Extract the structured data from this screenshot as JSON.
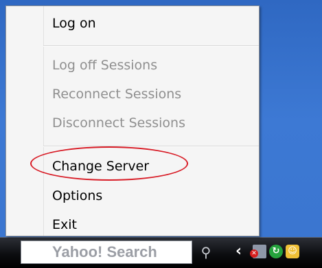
{
  "menu": {
    "items": [
      {
        "label": "Log on",
        "enabled": true
      },
      {
        "label": "Log off Sessions",
        "enabled": false
      },
      {
        "label": "Reconnect Sessions",
        "enabled": false
      },
      {
        "label": "Disconnect Sessions",
        "enabled": false
      },
      {
        "label": "Change Server",
        "enabled": true,
        "highlighted": true
      },
      {
        "label": "Options",
        "enabled": true
      },
      {
        "label": "Exit",
        "enabled": true
      }
    ]
  },
  "taskbar": {
    "search_text": "Yahoo! Search",
    "tray_icons": [
      "network-error-icon",
      "refresh-icon",
      "messenger-icon"
    ]
  },
  "colors": {
    "desktop": "#3a75cf",
    "menu_background": "#f5f5f5",
    "disabled_text": "#8f8f8f",
    "annotation": "#d81c26"
  }
}
